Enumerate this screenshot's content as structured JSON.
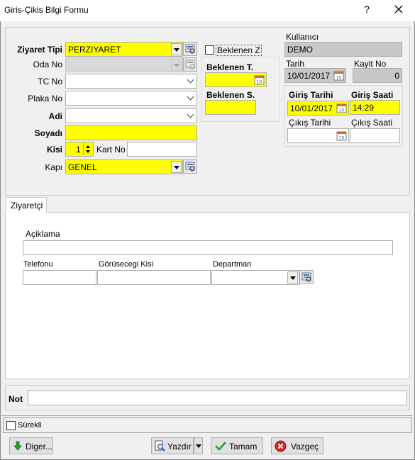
{
  "window": {
    "title": "Giris-Çikis Bilgi Formu",
    "help_label": "?"
  },
  "form": {
    "ziyaret_tipi": {
      "label": "Ziyaret Tipi",
      "value": "PERZIYARET"
    },
    "oda_no": {
      "label": "Oda No",
      "value": ""
    },
    "tc_no": {
      "label": "TC No",
      "value": ""
    },
    "plaka_no": {
      "label": "Plaka No",
      "value": ""
    },
    "adi": {
      "label": "Adi",
      "value": ""
    },
    "soyadi": {
      "label": "Soyadı",
      "value": ""
    },
    "kisi": {
      "label": "Kisi",
      "value": "1"
    },
    "kart_no": {
      "label": "Kart No",
      "value": ""
    },
    "kapi": {
      "label": "Kapı",
      "value": "GENEL"
    }
  },
  "beklenen": {
    "z_label": "Beklenen Z",
    "t_label": "Beklenen T.",
    "t_value": "",
    "s_label": "Beklenen S.",
    "s_value": ""
  },
  "info": {
    "kullanici_label": "Kullanıcı",
    "kullanici_value": "DEMO",
    "tarih_label": "Tarih",
    "tarih_value": "10/01/2017",
    "kayit_no_label": "Kayit No",
    "kayit_no_value": "0"
  },
  "giris_cikis": {
    "giris_tarihi_label": "Giriş Tarihi",
    "giris_tarihi_value": "10/01/2017",
    "giris_saati_label": "Giriş Saati",
    "giris_saati_value": "14:29",
    "cikis_tarihi_label": "Çıkış Tarihi",
    "cikis_tarihi_value": "",
    "cikis_saati_label": "Çıkış Saati",
    "cikis_saati_value": ""
  },
  "tabs": [
    {
      "label": "Ziyaretçi"
    }
  ],
  "ziyaretci": {
    "aciklama_label": "Açiklama",
    "aciklama_value": "",
    "telefonu_label": "Telefonu",
    "telefonu_value": "",
    "gorusecegi_label": "Görüsecegi Kisi",
    "gorusecegi_value": "",
    "departman_label": "Departman",
    "departman_value": ""
  },
  "not": {
    "label": "Not",
    "value": ""
  },
  "surekli": {
    "label": "Sürekli",
    "checked": false
  },
  "buttons": {
    "diger": "Diger...",
    "yazdir": "Yazdır",
    "tamam": "Tamam",
    "vazgec": "Vazgeç"
  },
  "colors": {
    "required_field": "#ffff00",
    "readonly_field": "#c8c8c8"
  }
}
